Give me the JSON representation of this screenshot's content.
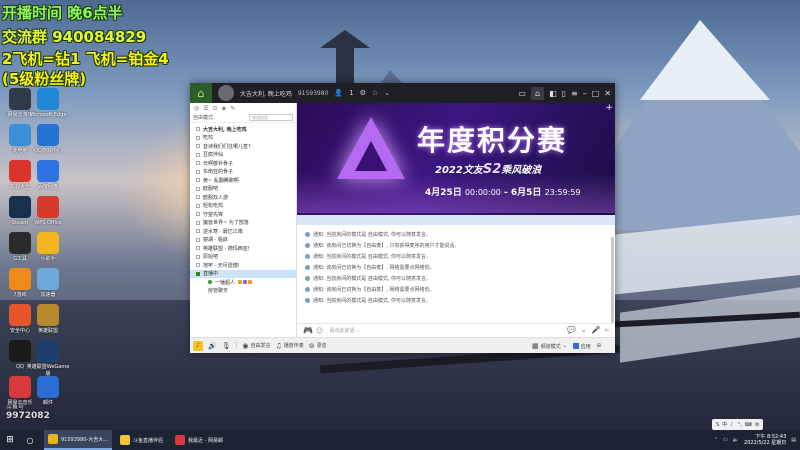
{
  "overlay": {
    "line1": "开播时间  晚6点半",
    "line2": "交流群 940084829",
    "line3": "2飞机=钻1 飞机=铂金4",
    "line4": "(5级粉丝牌)"
  },
  "desktop_icons": [
    {
      "label": "网易云游戏",
      "color": "#2e3a4a"
    },
    {
      "label": "Microsoft Edge",
      "color": "#1f88d6"
    },
    {
      "label": "此电脑",
      "color": "#3b8fd6"
    },
    {
      "label": "QQ游戏中心",
      "color": "#2474d4"
    },
    {
      "label": "影视大全",
      "color": "#d9342b"
    },
    {
      "label": "百度网盘",
      "color": "#2b72e3"
    },
    {
      "label": "Steam",
      "color": "#16304d"
    },
    {
      "label": "WPS Office",
      "color": "#d63a2a"
    },
    {
      "label": "G工具",
      "color": "#2b2b2b"
    },
    {
      "label": "小助手",
      "color": "#f3b521"
    },
    {
      "label": "7游戏",
      "color": "#f08a1a"
    },
    {
      "label": "加速器",
      "color": "#6fa9d9"
    },
    {
      "label": "安全中心",
      "color": "#e8542a"
    },
    {
      "label": "英雄联盟",
      "color": "#b8892d"
    },
    {
      "label": "QQ",
      "color": "#1a1a1a"
    },
    {
      "label": "英雄联盟WeGame版",
      "color": "#1e3f6e"
    },
    {
      "label": "网易云音乐",
      "color": "#d63a3a"
    },
    {
      "label": "邮件",
      "color": "#2a6ed3"
    }
  ],
  "window": {
    "title": "大吉大利, 晚上吃鸡",
    "room_id": "91593980",
    "user_count": "1",
    "channel_toolbar": {
      "mode_label": "自由模式",
      "search_placeholder": "频道搜索"
    },
    "channels": [
      {
        "label": "大吉大利, 晚上吃鸡",
        "bold": true
      },
      {
        "label": "吃鸡",
        "bold": false
      },
      {
        "label": "音诗我们们往哪儿签?",
        "bold": false
      },
      {
        "label": "豆腐伴仙",
        "bold": false
      },
      {
        "label": "日啊敬补骨子",
        "bold": false
      },
      {
        "label": "东南亚的骨子",
        "bold": false
      },
      {
        "label": "黄~ 乱翻腾聊啊",
        "bold": false
      },
      {
        "label": "欧服吧",
        "bold": false
      },
      {
        "label": "欧服双人游",
        "bold": false
      },
      {
        "label": "轻松吃鸡",
        "bold": false
      },
      {
        "label": "守望先锋",
        "bold": false
      },
      {
        "label": "魔兽世界~ 为了部落",
        "bold": false
      },
      {
        "label": "逆水寒 · 最忆江南",
        "bold": false
      },
      {
        "label": "镜湖 · 临启",
        "bold": false
      },
      {
        "label": "英雄联盟 · 德玛西亚!",
        "bold": false
      },
      {
        "label": "原始吧",
        "bold": false
      },
      {
        "label": "地牢 · 无尽遗憾!",
        "bold": false
      },
      {
        "label": "直播中",
        "bold": false,
        "active": true
      }
    ],
    "live_user": "一锤超人",
    "manage_channel": "房管聊天",
    "banner": {
      "title": "年度积分赛",
      "subtitle_a": "2022文友",
      "subtitle_s2": "S2",
      "subtitle_b": "乘风破浪",
      "date_start": "4月25日",
      "time_start": "00:00:00",
      "date_end": "6月5日",
      "time_end": "23:59:59"
    },
    "messages": [
      "通知: 当前房间的模式是 自由模式, 你可以随意发言。",
      "通知: 该房间已切换为【自由麦】, 只有获得麦序的用户才能说话。",
      "通知: 当前房间的模式是 自由模式, 你可以随意发言。",
      "通知: 该房间已切换为【自由麦】, 网络需要点网络低。",
      "通知: 当前房间的模式是 自由模式, 你可以随意发言。",
      "通知: 该房间已切换为【自由麦】, 网络需要点网络低。",
      "通知: 当前房间的模式是 自由模式, 你可以随意发言。"
    ],
    "input_placeholder": "请点此说话...",
    "bottom_bar": {
      "free_speech": "自由发言",
      "play_music": "播放伴奏",
      "record": "录音",
      "channel_mode": "频道模式",
      "app_center": "应用"
    }
  },
  "taskbar": {
    "tasks": [
      {
        "label": "91593980-大吉大...",
        "active": true
      },
      {
        "label": "斗鱼直播伴侣",
        "active": false
      },
      {
        "label": "我最近 - 网易邮",
        "active": false
      }
    ],
    "ime_label": "中",
    "time": "下午 8:52:43",
    "date": "2022/5/22 星期日"
  },
  "watermark": {
    "site": "斗鱼号",
    "room": "9972082"
  }
}
